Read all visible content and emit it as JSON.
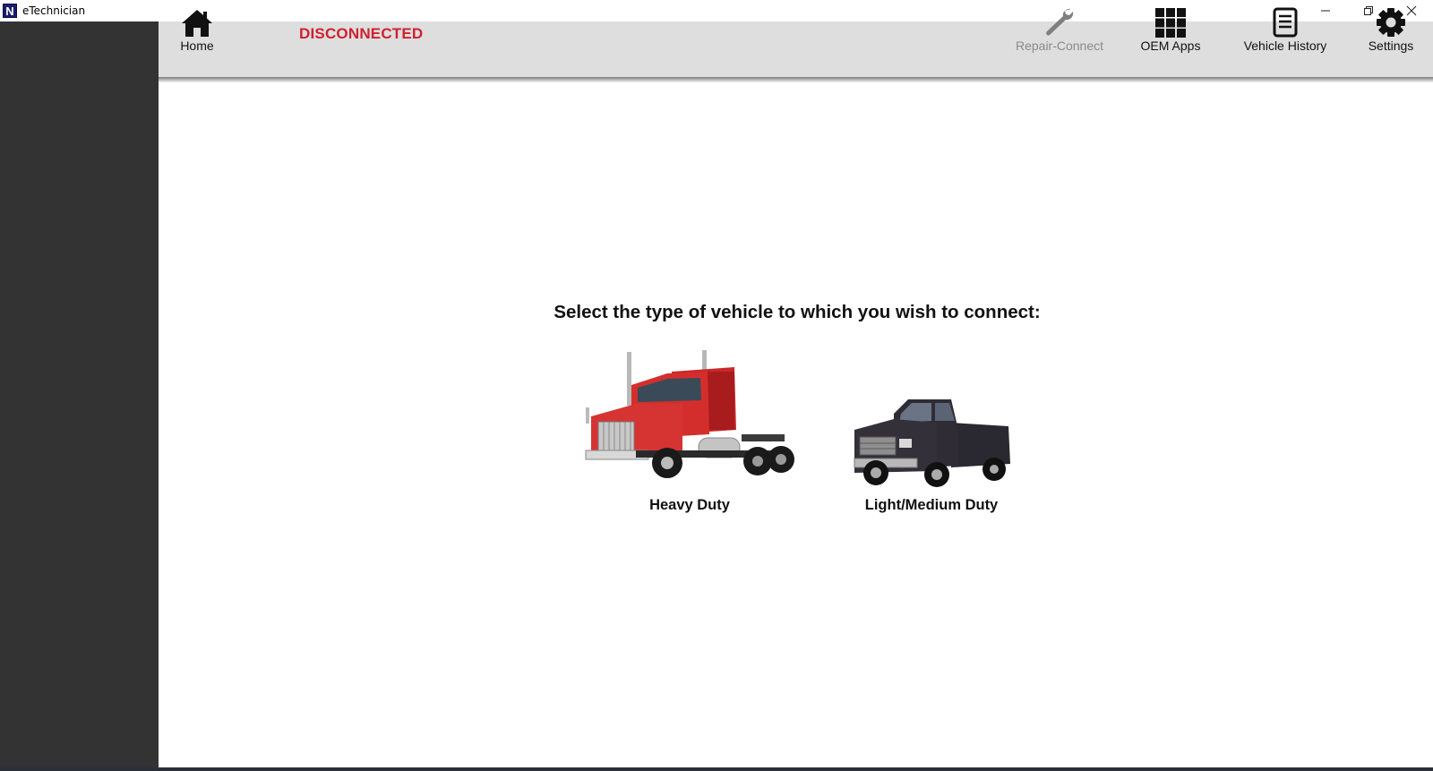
{
  "window": {
    "title": "eTechnician",
    "logo_letter": "N"
  },
  "toolbar": {
    "status": "DISCONNECTED",
    "home_label": "Home",
    "repair_connect_label": "Repair-Connect",
    "oem_apps_label": "OEM Apps",
    "vehicle_history_label": "Vehicle History",
    "settings_label": "Settings"
  },
  "main": {
    "prompt": "Select the type of vehicle to which you wish to connect:",
    "vehicles": [
      {
        "label": "Heavy Duty",
        "icon": "semi-truck-image"
      },
      {
        "label": "Light/Medium Duty",
        "icon": "pickup-truck-image"
      }
    ]
  },
  "colors": {
    "sidebar": "#333333",
    "toolbar": "#dedede",
    "status": "#d02030"
  }
}
